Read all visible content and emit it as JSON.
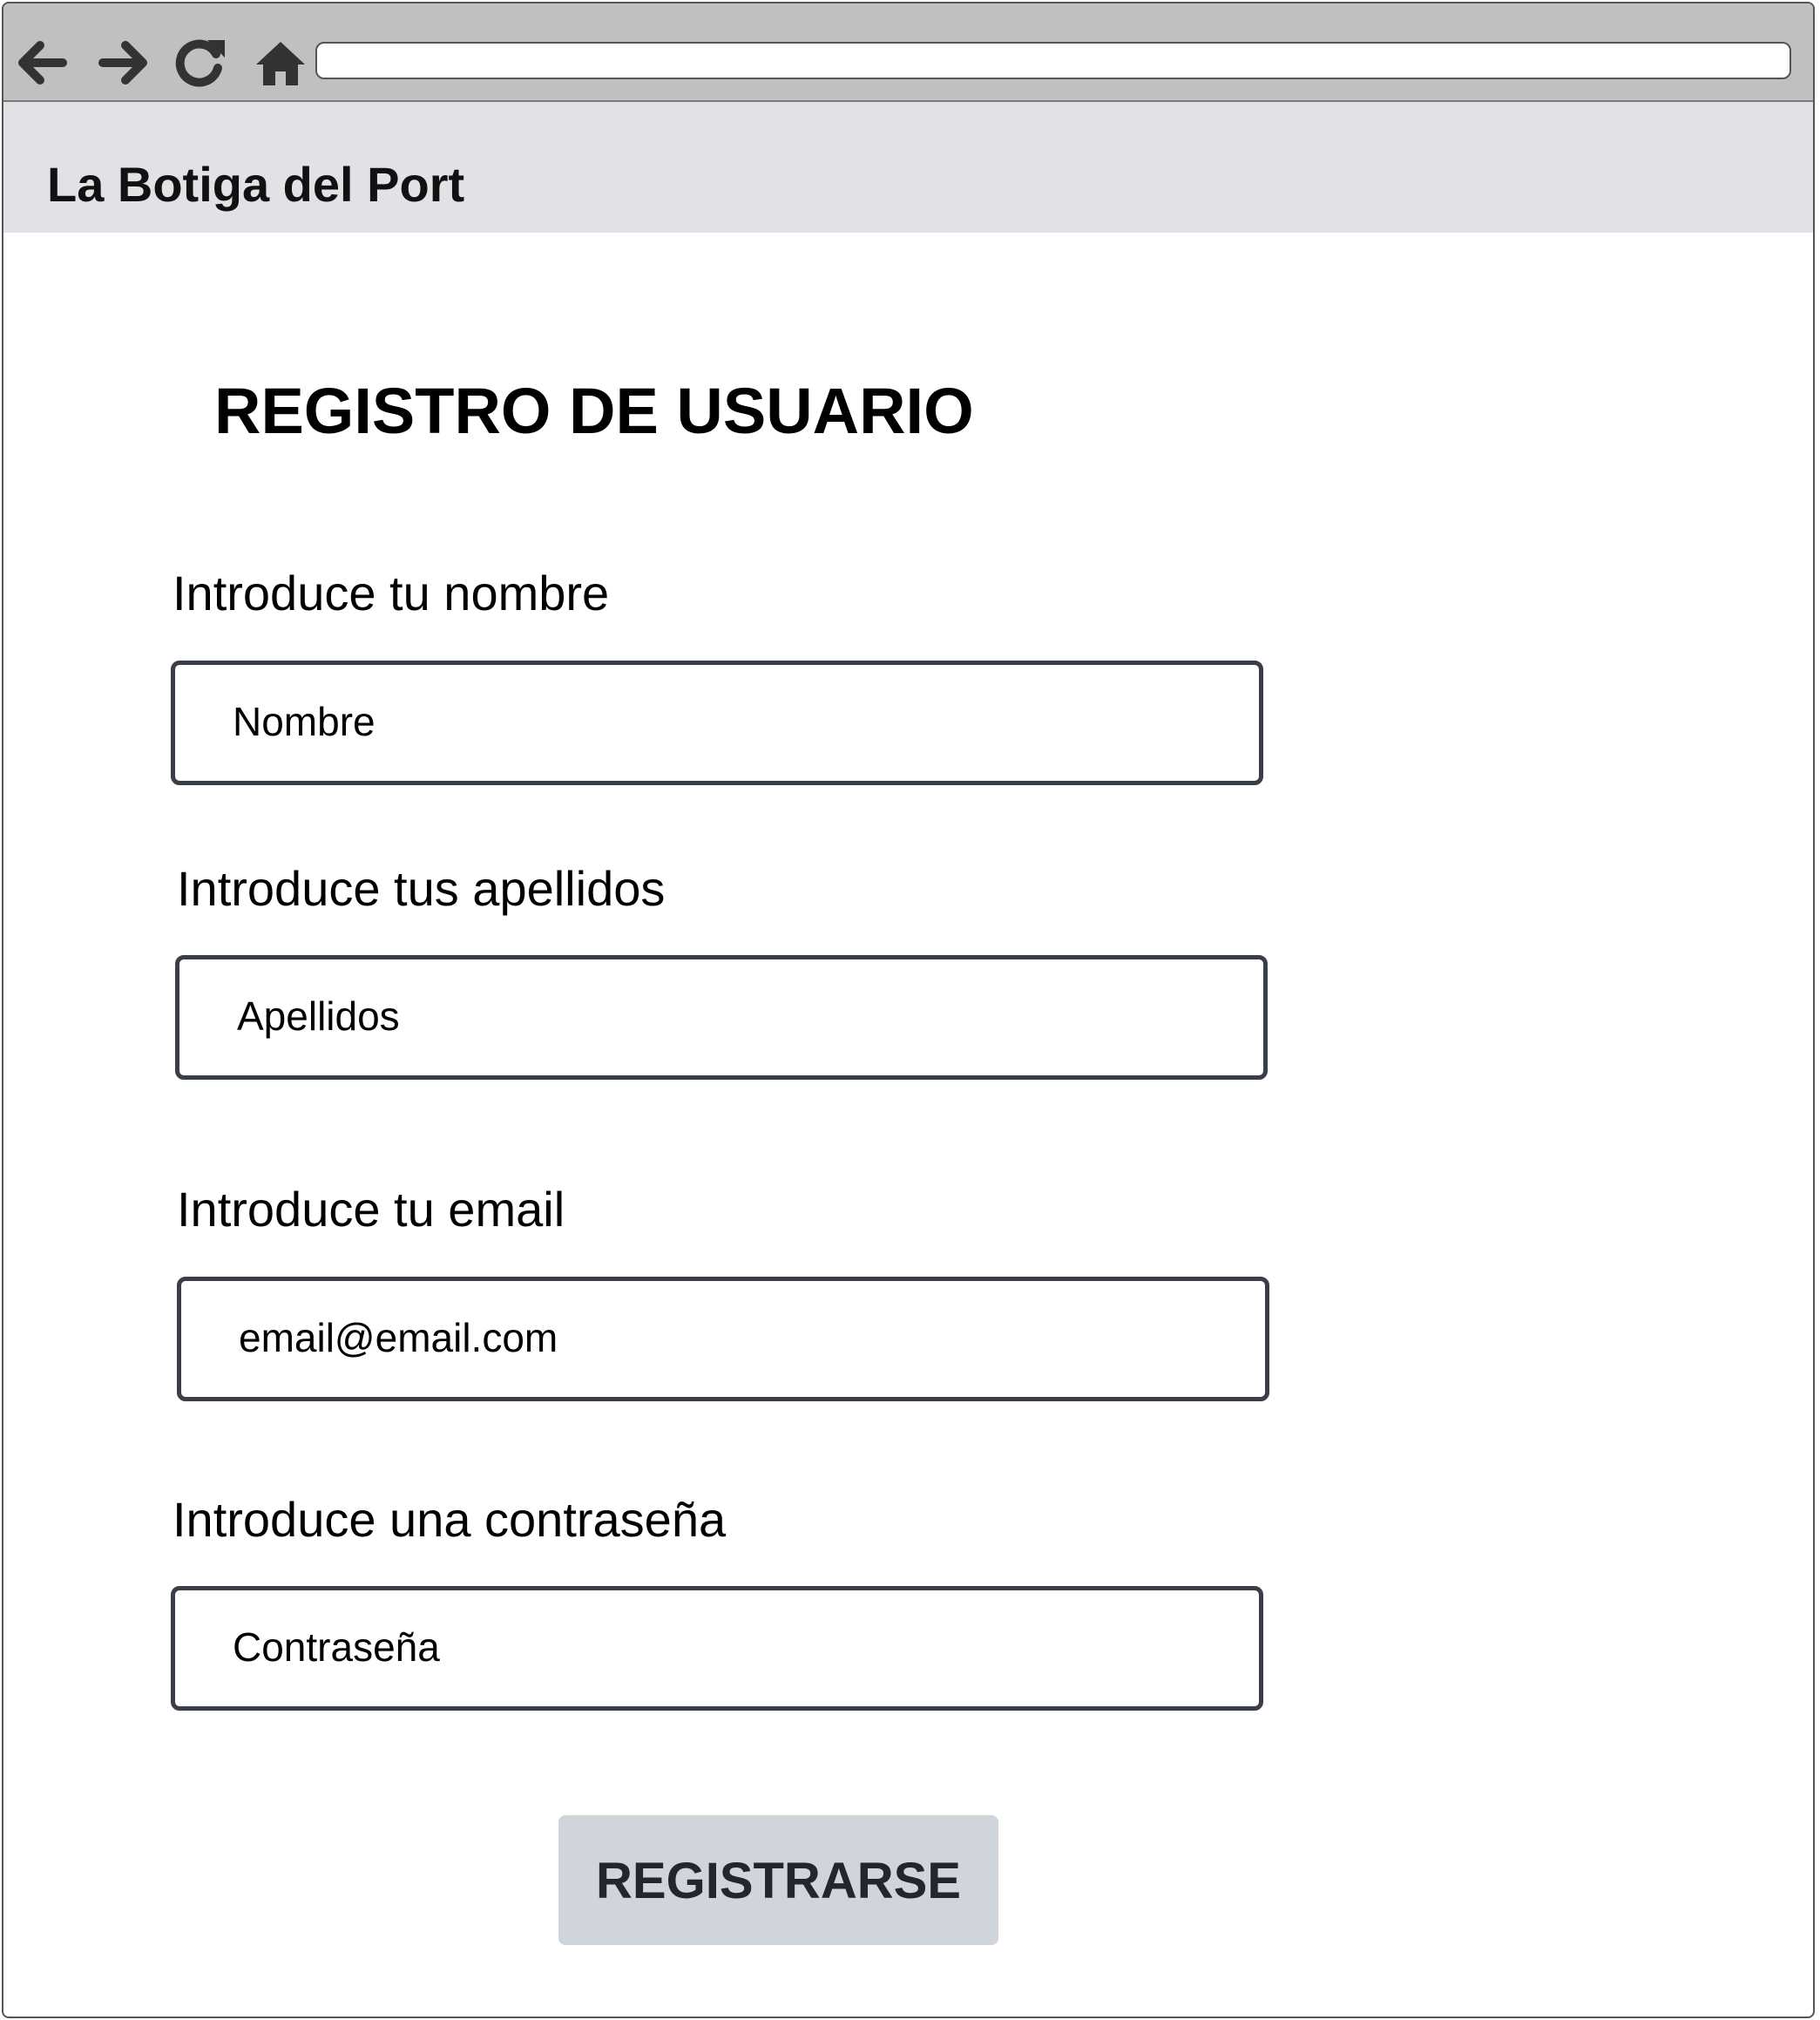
{
  "browser": {
    "toolbar_icons": [
      "back-arrow-icon",
      "forward-arrow-icon",
      "reload-icon",
      "home-icon"
    ],
    "address_bar_value": ""
  },
  "header": {
    "site_title": "La Botiga del Port"
  },
  "main": {
    "page_title": "REGISTRO DE USUARIO",
    "fields": [
      {
        "label": "Introduce tu nombre",
        "placeholder": "Nombre"
      },
      {
        "label": "Introduce tus apellidos",
        "placeholder": "Apellidos"
      },
      {
        "label": "Introduce tu email",
        "placeholder": "email@email.com"
      },
      {
        "label": "Introduce una contraseña",
        "placeholder": "Contraseña"
      }
    ],
    "submit_label": "REGISTRARSE"
  },
  "colors": {
    "toolbar_bg": "#c0c0c0",
    "header_bg": "#e0e2e6",
    "input_border": "#3a3f47",
    "button_bg": "#d0d4db",
    "icon_color": "#333333"
  }
}
